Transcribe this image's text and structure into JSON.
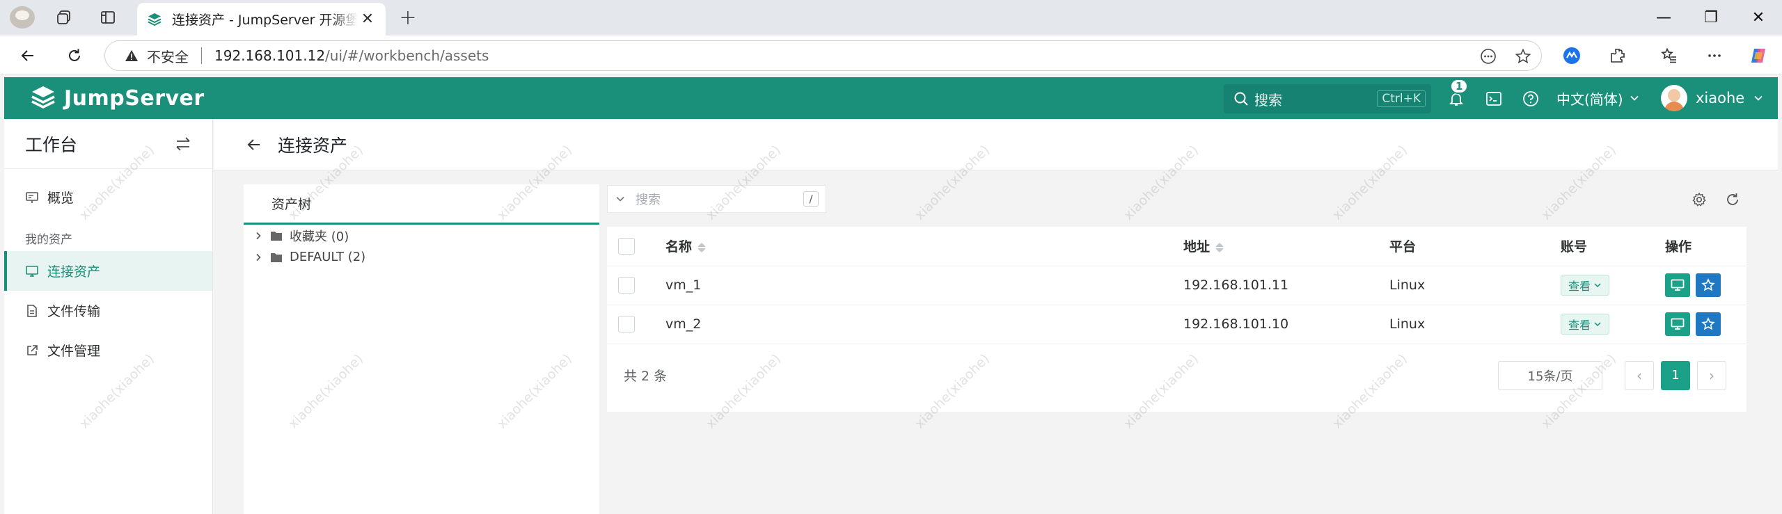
{
  "browser": {
    "tab": {
      "title": "连接资产 - JumpServer 开源堡垒机",
      "close_label": "✕"
    },
    "new_tab_label": "+",
    "address": {
      "security_label": "不安全",
      "url_host": "192.168.101.12",
      "url_path": "/ui/#/workbench/assets"
    },
    "window_controls": {
      "minimize": "—",
      "restore": "❐",
      "close": "✕"
    }
  },
  "app": {
    "brand": "JumpServer",
    "brand_color": "#1a8f7a",
    "header": {
      "search_placeholder": "搜索",
      "search_shortcut": "Ctrl+K",
      "notification_count": "1",
      "language": "中文(简体)",
      "username": "xiaohe"
    },
    "sidebar": {
      "title": "工作台",
      "items_top": [
        {
          "label": "概览",
          "icon": "dashboard-icon"
        }
      ],
      "group_label": "我的资产",
      "items": [
        {
          "label": "连接资产",
          "icon": "monitor-icon",
          "active": true
        },
        {
          "label": "文件传输",
          "icon": "file-transfer-icon",
          "active": false
        },
        {
          "label": "文件管理",
          "icon": "external-link-icon",
          "active": false
        }
      ]
    },
    "page": {
      "title": "连接资产",
      "tree": {
        "tab_label": "资产树",
        "nodes": [
          {
            "label": "收藏夹 (0)"
          },
          {
            "label": "DEFAULT (2)"
          }
        ]
      },
      "search": {
        "placeholder": "搜索",
        "shortcut": "/"
      },
      "table": {
        "columns": {
          "name": "名称",
          "address": "地址",
          "platform": "平台",
          "account": "账号",
          "actions": "操作"
        },
        "rows": [
          {
            "name": "vm_1",
            "address": "192.168.101.11",
            "platform": "Linux",
            "account_btn": "查看"
          },
          {
            "name": "vm_2",
            "address": "192.168.101.10",
            "platform": "Linux",
            "account_btn": "查看"
          }
        ]
      },
      "pagination": {
        "total": "共 2 条",
        "page_size": "15条/页",
        "prev": "‹",
        "next": "›",
        "current_page": "1"
      }
    },
    "watermark_text": "xiaohe(xiaohe)"
  }
}
